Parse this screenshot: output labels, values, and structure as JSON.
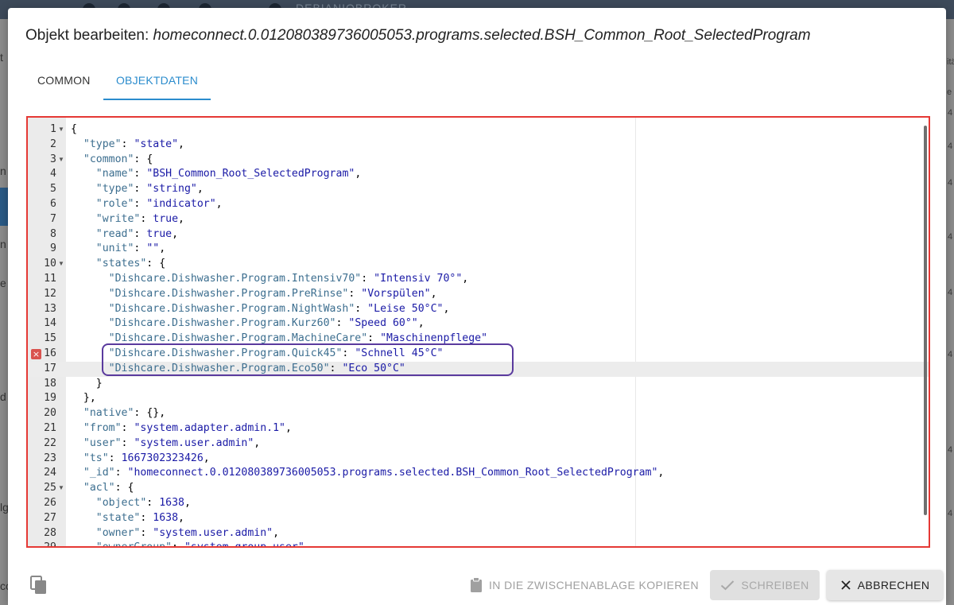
{
  "background": {
    "app_title": "DEBIANIOBROKER",
    "left_letters": [
      "t",
      "n",
      "n",
      "e",
      "d",
      "lg",
      "cc"
    ],
    "right_letters": [
      "itä",
      "e",
      "4",
      "4",
      "4",
      "4",
      "4",
      "4",
      "4",
      "4",
      "4",
      "4",
      "4",
      "4",
      "4",
      "4",
      "4",
      "4",
      "4",
      "4",
      "4",
      "4",
      "4",
      "4",
      "4",
      "4"
    ]
  },
  "dialog": {
    "title_prefix": "Objekt bearbeiten: ",
    "title_path": "homeconnect.0.012080389736005053.programs.selected.BSH_Common_Root_SelectedProgram"
  },
  "tabs": [
    {
      "label": "COMMON",
      "active": false
    },
    {
      "label": "OBJEKTDATEN",
      "active": true
    }
  ],
  "editor": {
    "lines": [
      {
        "n": "1",
        "fold": true,
        "text": "{"
      },
      {
        "n": "2",
        "text": "  \"type\": \"state\","
      },
      {
        "n": "3",
        "fold": true,
        "text": "  \"common\": {"
      },
      {
        "n": "4",
        "text": "    \"name\": \"BSH_Common_Root_SelectedProgram\","
      },
      {
        "n": "5",
        "text": "    \"type\": \"string\","
      },
      {
        "n": "6",
        "text": "    \"role\": \"indicator\","
      },
      {
        "n": "7",
        "text": "    \"write\": true,"
      },
      {
        "n": "8",
        "text": "    \"read\": true,"
      },
      {
        "n": "9",
        "text": "    \"unit\": \"\","
      },
      {
        "n": "10",
        "fold": true,
        "text": "    \"states\": {"
      },
      {
        "n": "11",
        "text": "      \"Dishcare.Dishwasher.Program.Intensiv70\": \"Intensiv 70°\","
      },
      {
        "n": "12",
        "text": "      \"Dishcare.Dishwasher.Program.PreRinse\": \"Vorspülen\","
      },
      {
        "n": "13",
        "text": "      \"Dishcare.Dishwasher.Program.NightWash\": \"Leise 50°C\","
      },
      {
        "n": "14",
        "text": "      \"Dishcare.Dishwasher.Program.Kurz60\": \"Speed 60°\","
      },
      {
        "n": "15",
        "text": "      \"Dishcare.Dishwasher.Program.MachineCare\": \"Maschinenpflege\""
      },
      {
        "n": "16",
        "error": true,
        "text": "      \"Dishcare.Dishwasher.Program.Quick45\": \"Schnell 45°C\""
      },
      {
        "n": "17",
        "active": true,
        "text": "      \"Dishcare.Dishwasher.Program.Eco50\": \"Eco 50°C\""
      },
      {
        "n": "18",
        "text": "    }"
      },
      {
        "n": "19",
        "text": "  },"
      },
      {
        "n": "20",
        "text": "  \"native\": {},"
      },
      {
        "n": "21",
        "text": "  \"from\": \"system.adapter.admin.1\","
      },
      {
        "n": "22",
        "text": "  \"user\": \"system.user.admin\","
      },
      {
        "n": "23",
        "text": "  \"ts\": 1667302323426,"
      },
      {
        "n": "24",
        "text": "  \"_id\": \"homeconnect.0.012080389736005053.programs.selected.BSH_Common_Root_SelectedProgram\","
      },
      {
        "n": "25",
        "fold": true,
        "text": "  \"acl\": {"
      },
      {
        "n": "26",
        "text": "    \"object\": 1638,"
      },
      {
        "n": "27",
        "text": "    \"state\": 1638,"
      },
      {
        "n": "28",
        "text": "    \"owner\": \"system.user.admin\","
      },
      {
        "n": "29",
        "text": "    \"ownerGroup\": \"system.group.user\""
      }
    ]
  },
  "footer": {
    "copy_clipboard_label": "IN DIE ZWISCHENABLAGE KOPIEREN",
    "write_label": "SCHREIBEN",
    "cancel_label": "ABBRECHEN"
  },
  "icons": {
    "copy": "copy-icon",
    "clipboard": "clipboard-icon",
    "check": "check-icon",
    "close": "close-icon",
    "error": "error-marker-icon",
    "fold": "fold-arrow-icon"
  },
  "colors": {
    "accent": "#2b8ccd",
    "editor_border": "#e53935",
    "highlight": "#5a3a9e",
    "json_key": "#3c6e8f",
    "json_value": "#1a1aa6"
  }
}
